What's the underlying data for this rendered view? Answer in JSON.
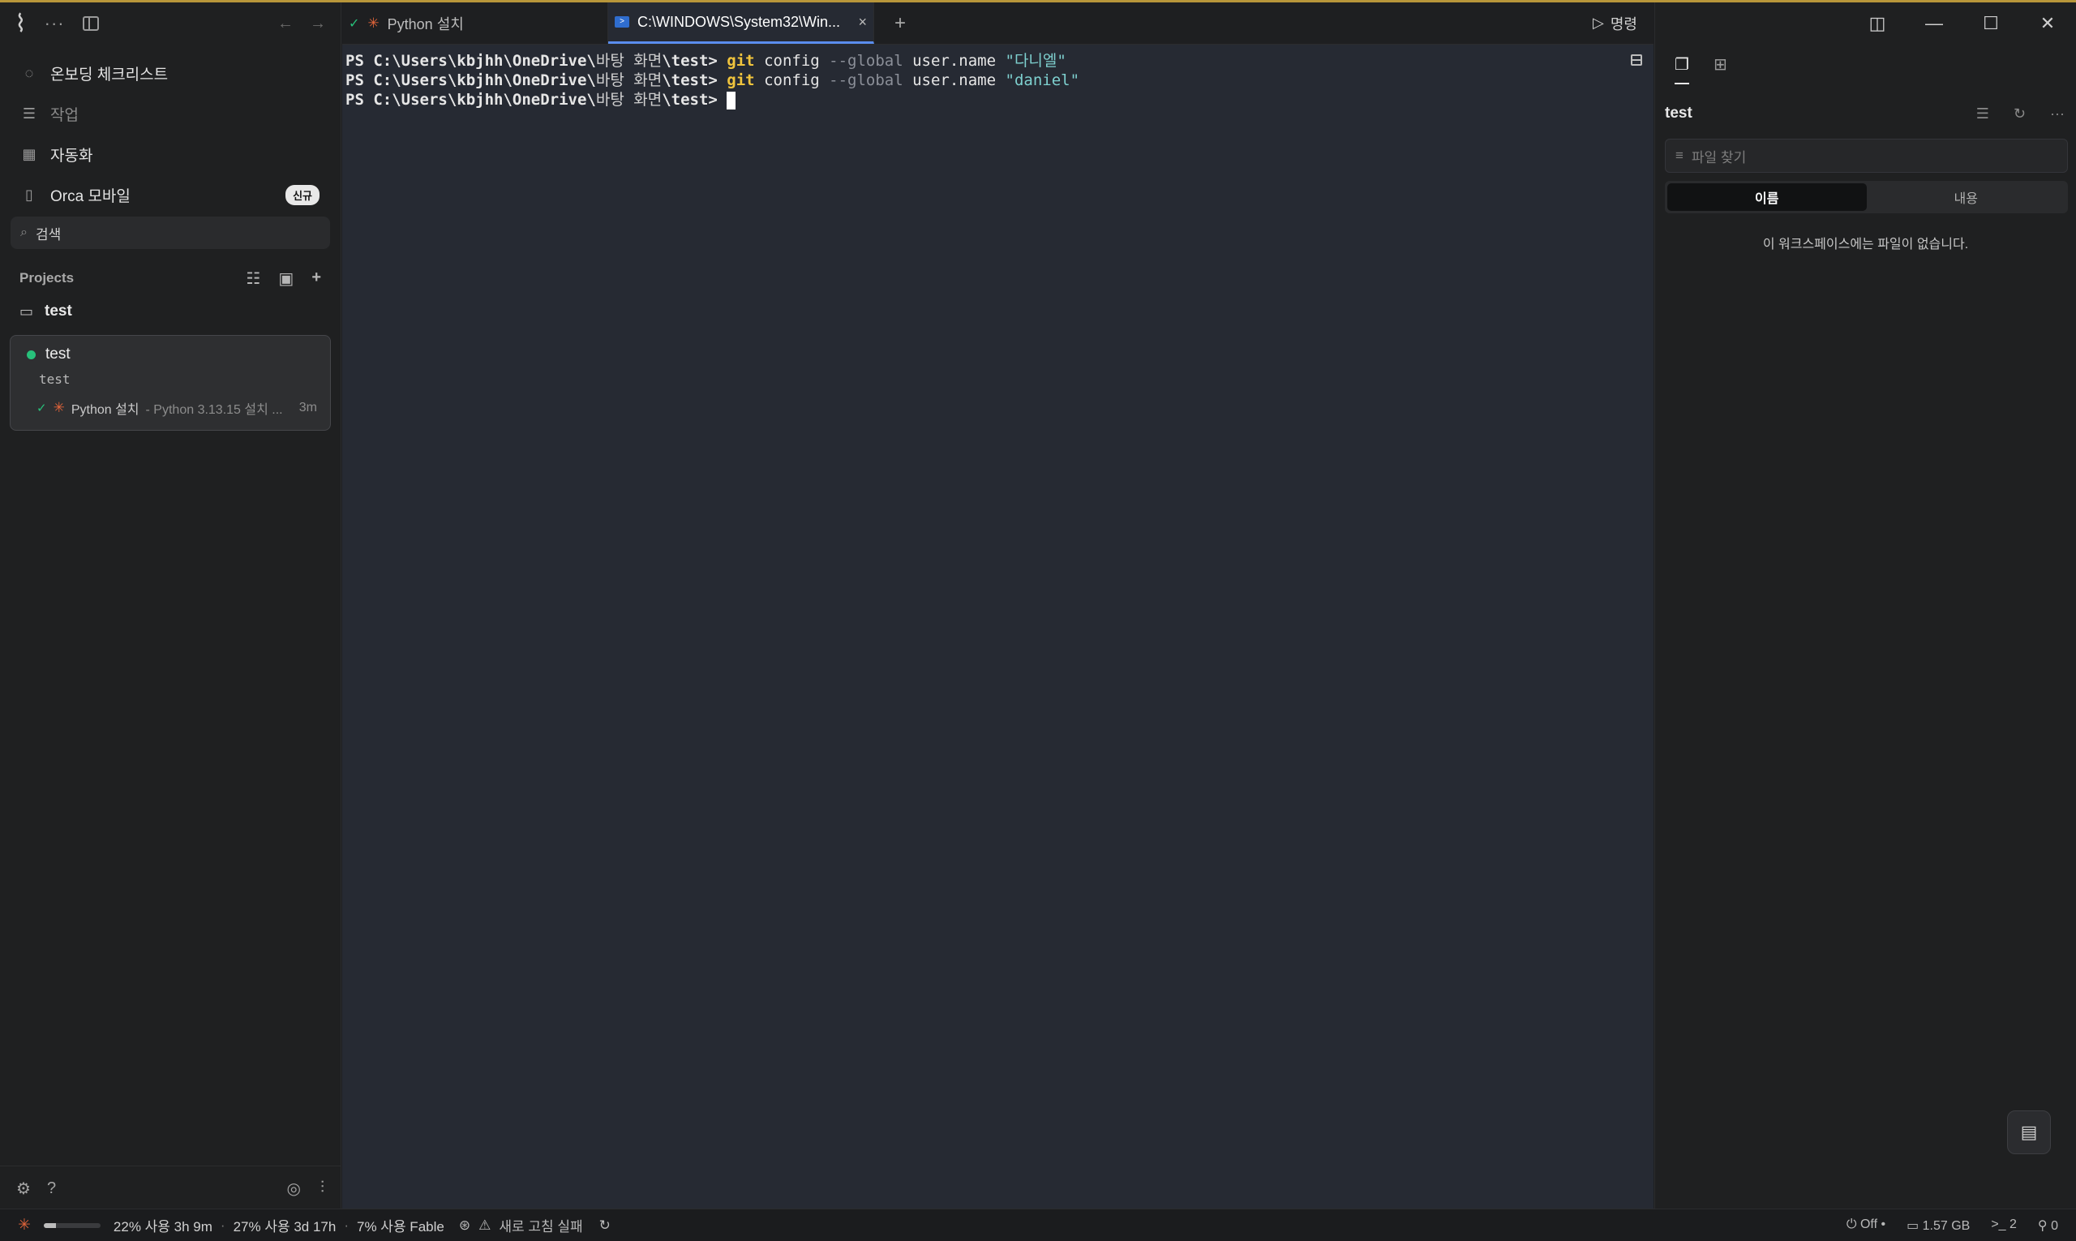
{
  "sidebar": {
    "items": [
      {
        "label": "온보딩 체크리스트",
        "icon": "spinner-icon"
      },
      {
        "label": "작업",
        "icon": "list-icon"
      },
      {
        "label": "자동화",
        "icon": "calendar-icon"
      },
      {
        "label": "Orca 모바일",
        "icon": "phone-icon",
        "badge": "신규"
      }
    ],
    "search_label": "검색",
    "projects_label": "Projects",
    "folder": "test",
    "workspace": {
      "title": "test",
      "branch": "test",
      "task_name": "Python 설치",
      "task_sub": "- Python 3.13.15 설치 ...",
      "task_time": "3m"
    }
  },
  "tabs": [
    {
      "label": "Python 설치",
      "active": false
    },
    {
      "label": "C:\\WINDOWS\\System32\\Win...",
      "active": true
    }
  ],
  "run_label": "명령",
  "terminal": {
    "prompt_prefix": "PS C:\\Users\\kbjhh\\OneDrive\\",
    "prompt_korean": "바탕 화면",
    "prompt_suffix": "\\test> ",
    "lines": [
      {
        "cmd": "git",
        "plain1": " config ",
        "flag": "--global",
        "plain2": " user.name ",
        "str": "\"다니엘\""
      },
      {
        "cmd": "git",
        "plain1": " config ",
        "flag": "--global",
        "plain2": " user.name ",
        "str": "\"daniel\""
      }
    ]
  },
  "right_panel": {
    "title": "test",
    "search_placeholder": "파일 찾기",
    "seg_name": "이름",
    "seg_content": "내용",
    "empty_text": "이 워크스페이스에는 파일이 없습니다."
  },
  "statusbar": {
    "usage_fraction": 0.22,
    "usage1": "22% 사용 3h 9m",
    "usage2": "27% 사용 3d 17h",
    "usage3": "7% 사용 Fable",
    "refresh_fail": "새로 고침 실패",
    "off_label": "Off",
    "memory": "1.57 GB",
    "terminals": "2",
    "ports": "0"
  },
  "colors": {
    "accent": "#5a8dee",
    "ok": "#27c07a",
    "star": "#e0643a",
    "terminal_bg": "#262a33"
  }
}
